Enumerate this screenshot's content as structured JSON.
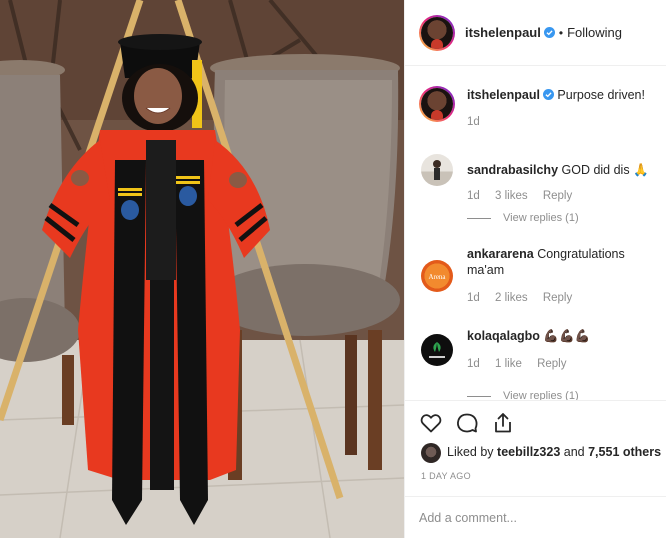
{
  "post_header": {
    "username": "itshelenpaul",
    "separator": "•",
    "follow_status": "Following",
    "avatar_icon": "avatar-icon",
    "verified_icon": "verified-badge-icon"
  },
  "caption": {
    "username": "itshelenpaul",
    "text": "Purpose driven!",
    "time": "1d"
  },
  "comments": [
    {
      "username": "sandrabasilchy",
      "text": "GOD did dis 🙏",
      "time": "1d",
      "likes": "3 likes",
      "reply_label": "Reply",
      "view_replies": "View replies (1)"
    },
    {
      "username": "ankararena",
      "text": "Congratulations ma'am",
      "time": "1d",
      "likes": "2 likes",
      "reply_label": "Reply"
    },
    {
      "username": "kolaqalagbo",
      "text": "💪🏿💪🏿💪🏿",
      "time": "1d",
      "likes": "1 like",
      "reply_label": "Reply",
      "view_replies": "View replies (1)"
    }
  ],
  "actions": {
    "like_icon": "heart-icon",
    "comment_icon": "comment-icon",
    "share_icon": "share-icon",
    "liked_by_prefix": "Liked by",
    "liked_by_user": "teebillz323",
    "and": "and",
    "others_count": "7,551 others",
    "time_ago": "1 DAY AGO"
  },
  "add_comment": {
    "placeholder": "Add a comment..."
  },
  "colors": {
    "verified": "#3897f0",
    "text": "#262626",
    "meta": "#8e8e8e",
    "gown_red": "#e8391f",
    "gown_black": "#111111"
  }
}
